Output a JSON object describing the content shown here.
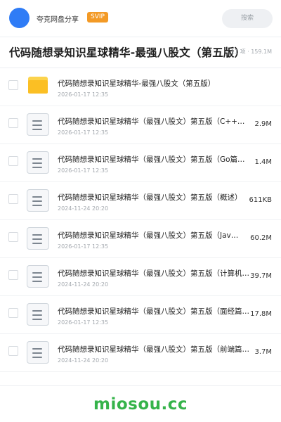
{
  "header": {
    "app_name": "夸克网盘分享",
    "vip_badge": "SVIP",
    "search_label": "搜索",
    "accent_color": "#2f7cf6"
  },
  "folder": {
    "title": "代码随想录知识星球精华-最强八股文（第五版）",
    "meta": "11 项 · 159.1M"
  },
  "files": [
    {
      "type": "folder",
      "icon": "folder-icon",
      "name": "代码随想录知识星球精华-最强八股文（第五版）",
      "date": "2026-01-17 12:35",
      "size": ""
    },
    {
      "type": "doc",
      "icon": "document-icon",
      "name": "代码随想录知识星球精华（最强八股文）第五版（C++…",
      "date": "2026-01-17 12:35",
      "size": "2.9M"
    },
    {
      "type": "doc",
      "icon": "document-icon",
      "name": "代码随想录知识星球精华（最强八股文）第五版（Go篇…",
      "date": "2026-01-17 12:35",
      "size": "1.4M"
    },
    {
      "type": "doc",
      "icon": "document-icon",
      "name": "代码随想录知识星球精华（最强八股文）第五版（概述）",
      "date": "2024-11-24 20:20",
      "size": "611KB"
    },
    {
      "type": "doc",
      "icon": "document-icon",
      "name": "代码随想录知识星球精华（最强八股文）第五版（Jav…",
      "date": "2026-01-17 12:35",
      "size": "60.2M"
    },
    {
      "type": "doc",
      "icon": "document-icon",
      "name": "代码随想录知识星球精华（最强八股文）第五版（计算机…",
      "date": "2024-11-24 20:20",
      "size": "39.7M"
    },
    {
      "type": "doc",
      "icon": "document-icon",
      "name": "代码随想录知识星球精华（最强八股文）第五版（面经篇…",
      "date": "2026-01-17 12:35",
      "size": "17.8M"
    },
    {
      "type": "doc",
      "icon": "document-icon",
      "name": "代码随想录知识星球精华（最强八股文）第五版（前端篇…",
      "date": "2024-11-24 20:20",
      "size": "3.7M"
    }
  ],
  "watermark": {
    "text": "miosou.cc",
    "color": "#35b34a"
  }
}
